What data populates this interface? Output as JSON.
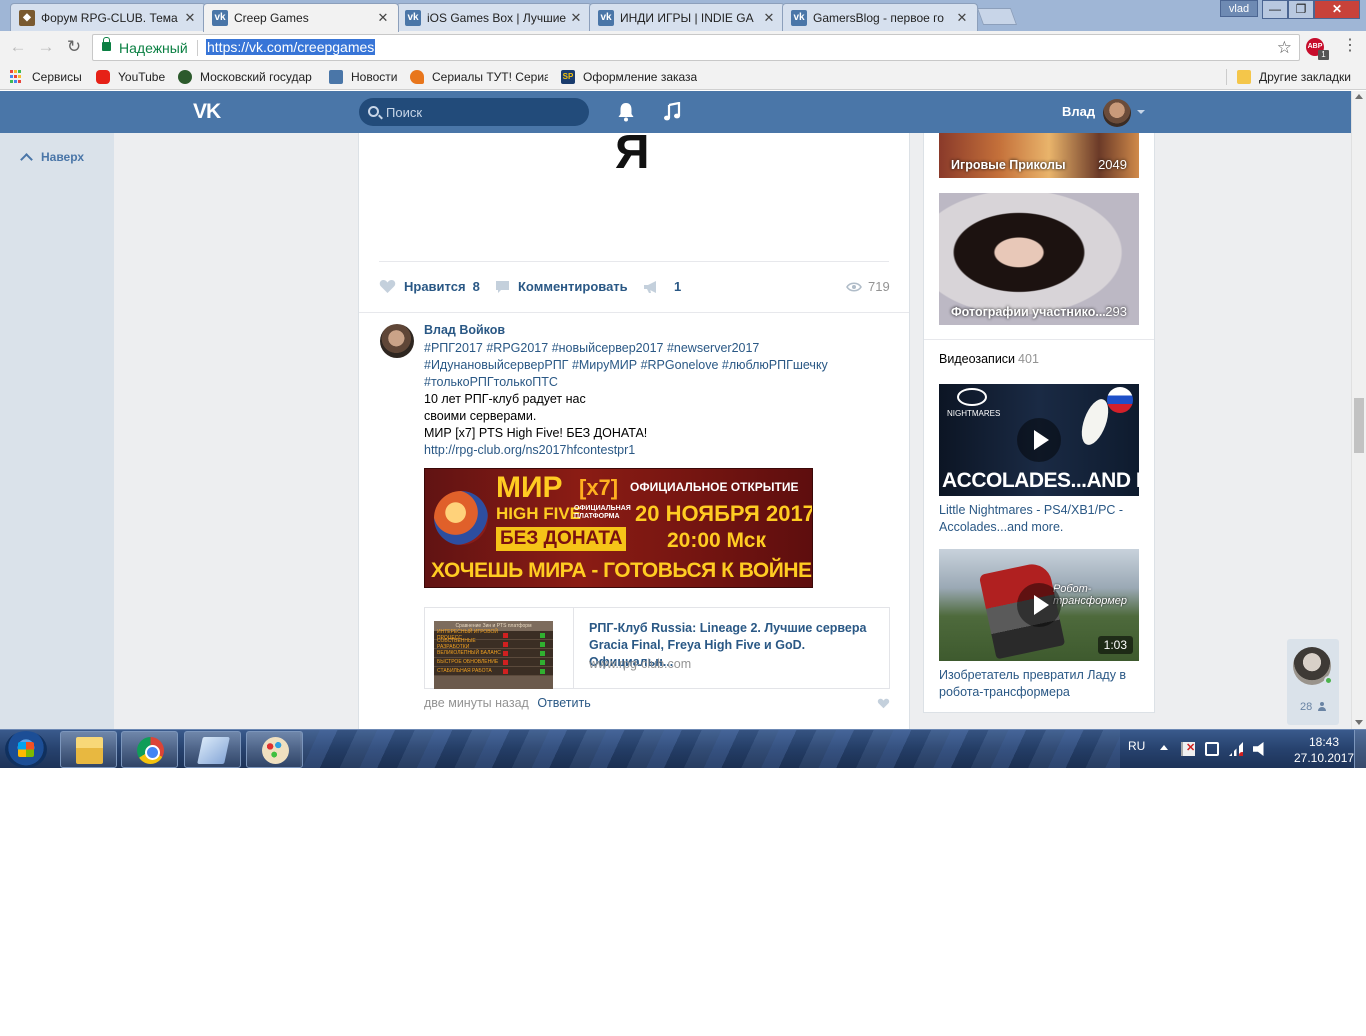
{
  "browser": {
    "window_user": "vlad",
    "tabs": [
      {
        "title": "Форум RPG-CLUB. Тема",
        "color": "#7a5a30",
        "icon": "rpg-club-favicon"
      },
      {
        "title": "Creep Games",
        "color": "#4a76a8",
        "icon": "vk-favicon",
        "active": true
      },
      {
        "title": "iOS Games Box | Лучшие",
        "color": "#4a76a8",
        "icon": "vk-favicon"
      },
      {
        "title": "ИНДИ ИГРЫ | INDIE GA",
        "color": "#4a76a8",
        "icon": "vk-favicon"
      },
      {
        "title": "GamersBlog - первое го",
        "color": "#4a76a8",
        "icon": "vk-favicon"
      }
    ],
    "tab_close": "✕",
    "secure_label": "Надежный",
    "url": "https://vk.com/creepgames",
    "adblock_badge": "ABP",
    "adblock_count": "1",
    "bookmarks": [
      {
        "label": "Сервисы",
        "icon": "apps-grid-icon"
      },
      {
        "label": "YouTube",
        "icon": "youtube-icon",
        "color": "#e62117"
      },
      {
        "label": "Московский государ",
        "icon": "emblem-icon",
        "color": "#2c5a2c"
      },
      {
        "label": "Новости",
        "icon": "news-icon",
        "color": "#4a76a8"
      },
      {
        "label": "Сериалы ТУТ! Сериа",
        "icon": "fox-icon",
        "color": "#e8761c"
      },
      {
        "label": "Оформление заказа",
        "icon": "sp-icon",
        "color": "#1a3c6e"
      }
    ],
    "other_bookmarks": "Другие закладки"
  },
  "vk": {
    "logo": "VK",
    "search_placeholder": "Поиск",
    "user_name": "Влад",
    "up_link": "Наверх",
    "post": {
      "big_letter": "Я",
      "like_label": "Нравится",
      "like_count": "8",
      "comment_label": "Комментировать",
      "share_count": "1",
      "views": "719"
    },
    "comment": {
      "author": "Влад Войков",
      "hashtags": [
        "#РПГ2017",
        "#RPG2017",
        "#новыйсервер2017",
        "#newserver2017",
        "#ИдунановыйсерверРПГ",
        "#МируМИР",
        "#RPGonelove",
        "#люблюРПГшечку",
        "#толькоРПГтолькоПТС"
      ],
      "lines": [
        "10 лет РПГ-клуб радует нас",
        "своими серверами.",
        "МИР [x7] PTS High Five! БЕЗ ДОНАТА!"
      ],
      "link": "http://rpg-club.org/ns2017hfcontestpr1",
      "banner": {
        "mir": "МИР",
        "x7": "[x7]",
        "highfive": "HIGH FIVE",
        "platform": "ОФИЦИАЛЬНАЯ ПЛАТФОРМА",
        "nodon": "БЕЗ ДОНАТА",
        "official": "ОФИЦИАЛЬНОЕ ОТКРЫТИЕ",
        "date": "20 НОЯБРЯ 2017",
        "time": "20:00 Мск",
        "war": "ХОЧЕШЬ МИРА - ГОТОВЬСЯ К ВОЙНЕ"
      },
      "card": {
        "thumb_title": "Сравнение Зин и PTS платформ",
        "thumb_rows": [
          "ИНТЕРЕСНЫЙ ИГРОВОЙ ПРОЦЕСС",
          "СОБСТВЕННЫЕ РАЗРАБОТКИ",
          "ВЕЛИКОЛЕПНЫЙ БАЛАНС",
          "БЫСТРОЕ ОБНОВЛЕНИЕ",
          "СТАБИЛЬНАЯ РАБОТА"
        ],
        "title": "РПГ-Клуб Russia: Lineage 2. Лучшие сервера Gracia Final, Freya High Five и GoD. Официальн...",
        "domain": "www.rpg-club.com"
      },
      "time": "две минуты назад",
      "reply": "Ответить"
    },
    "albums": [
      {
        "title": "Игровые Приколы",
        "count": "2049"
      },
      {
        "title": "Фотографии участнико...",
        "count": "293"
      }
    ],
    "videos_header": "Видеозаписи",
    "videos_count": "401",
    "videos": [
      {
        "title": "Little Nightmares - PS4/XB1/PC - Accolades...and more.",
        "overlay": "ACCOLADES...AND MORE",
        "brand": "NIGHTMARES",
        "duration": ""
      },
      {
        "title": "Изобретатель превратил Ладу в робота-трансформера",
        "overlay": "Робот-трансформер",
        "duration": "1:03"
      }
    ],
    "friends_online": "28"
  },
  "taskbar": {
    "lang": "RU",
    "time": "18:43",
    "date": "27.10.2017"
  }
}
